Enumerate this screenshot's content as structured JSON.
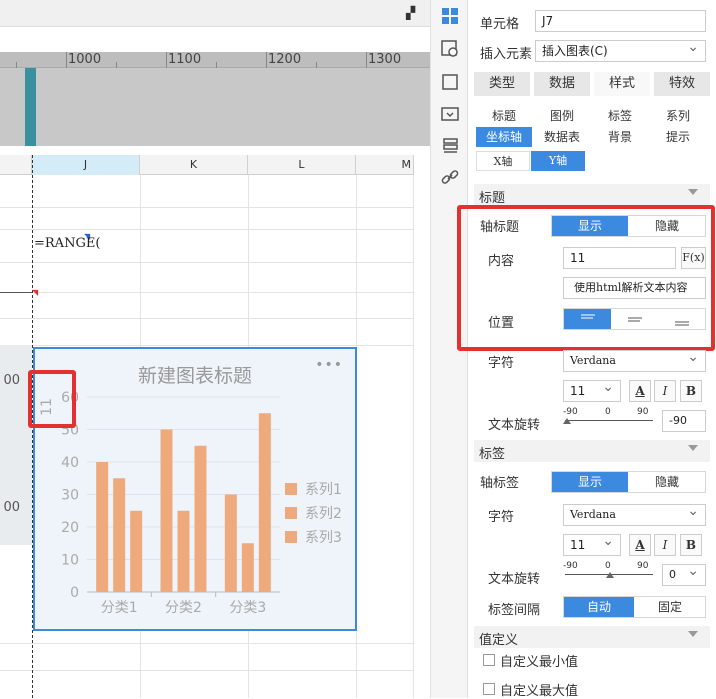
{
  "ruler": {
    "labels": [
      "1000",
      "1100",
      "1200",
      "1300"
    ]
  },
  "sheet": {
    "columns": [
      "J",
      "K",
      "L",
      "M"
    ],
    "formula": "=RANGE(",
    "left_values": [
      "00",
      "00"
    ]
  },
  "chart": {
    "title": "新建图表标题",
    "more": "•••",
    "axis_title": "11",
    "legend": [
      "系列1",
      "系列2",
      "系列3"
    ]
  },
  "chart_data": {
    "type": "bar",
    "title": "新建图表标题",
    "ylabel": "11",
    "categories": [
      "分类1",
      "分类2",
      "分类3"
    ],
    "series": [
      {
        "name": "系列1",
        "values": [
          40,
          50,
          30
        ]
      },
      {
        "name": "系列2",
        "values": [
          35,
          25,
          15
        ]
      },
      {
        "name": "系列3",
        "values": [
          25,
          45,
          55
        ]
      }
    ],
    "yticks": [
      "0",
      "10",
      "20",
      "30",
      "40",
      "50",
      "60"
    ],
    "ylim": [
      0,
      60
    ],
    "bar_color": "#eeaa7c",
    "legend_position": "right"
  },
  "panel": {
    "cell_label": "单元格",
    "cell_value": "J7",
    "insert_label": "插入元素",
    "insert_value": "插入图表(C)",
    "tabs": [
      "类型",
      "数据",
      "样式",
      "特效"
    ],
    "subtabs_row1": [
      "标题",
      "图例",
      "标签",
      "系列"
    ],
    "subtabs_row2": [
      "坐标轴",
      "数据表",
      "背景",
      "提示"
    ],
    "axis_tabs": [
      "X轴",
      "Y轴"
    ],
    "section_title": "标题",
    "axis_title_label": "轴标题",
    "show": "显示",
    "hide": "隐藏",
    "content_label": "内容",
    "content_value": "11",
    "formula_btn": "F(x)",
    "html_option": "使用html解析文本内容",
    "position_label": "位置",
    "font_label": "字符",
    "font_value": "Verdana",
    "font_size": "11",
    "color_btn": "A",
    "italic_btn": "I",
    "bold_btn": "B",
    "rotate_label": "文本旋转",
    "slider_nums": [
      "-90",
      "0",
      "90"
    ],
    "rotate_value1": "-90",
    "section_label": "标签",
    "axis_label_label": "轴标签",
    "rotate_value2": "0",
    "interval_label": "标签间隔",
    "auto": "自动",
    "fixed": "固定",
    "section_value": "值定义",
    "custom_min": "自定义最小值",
    "custom_max": "自定义最大值",
    "accent": "#3b8ae0",
    "highlight": "#e53030"
  }
}
